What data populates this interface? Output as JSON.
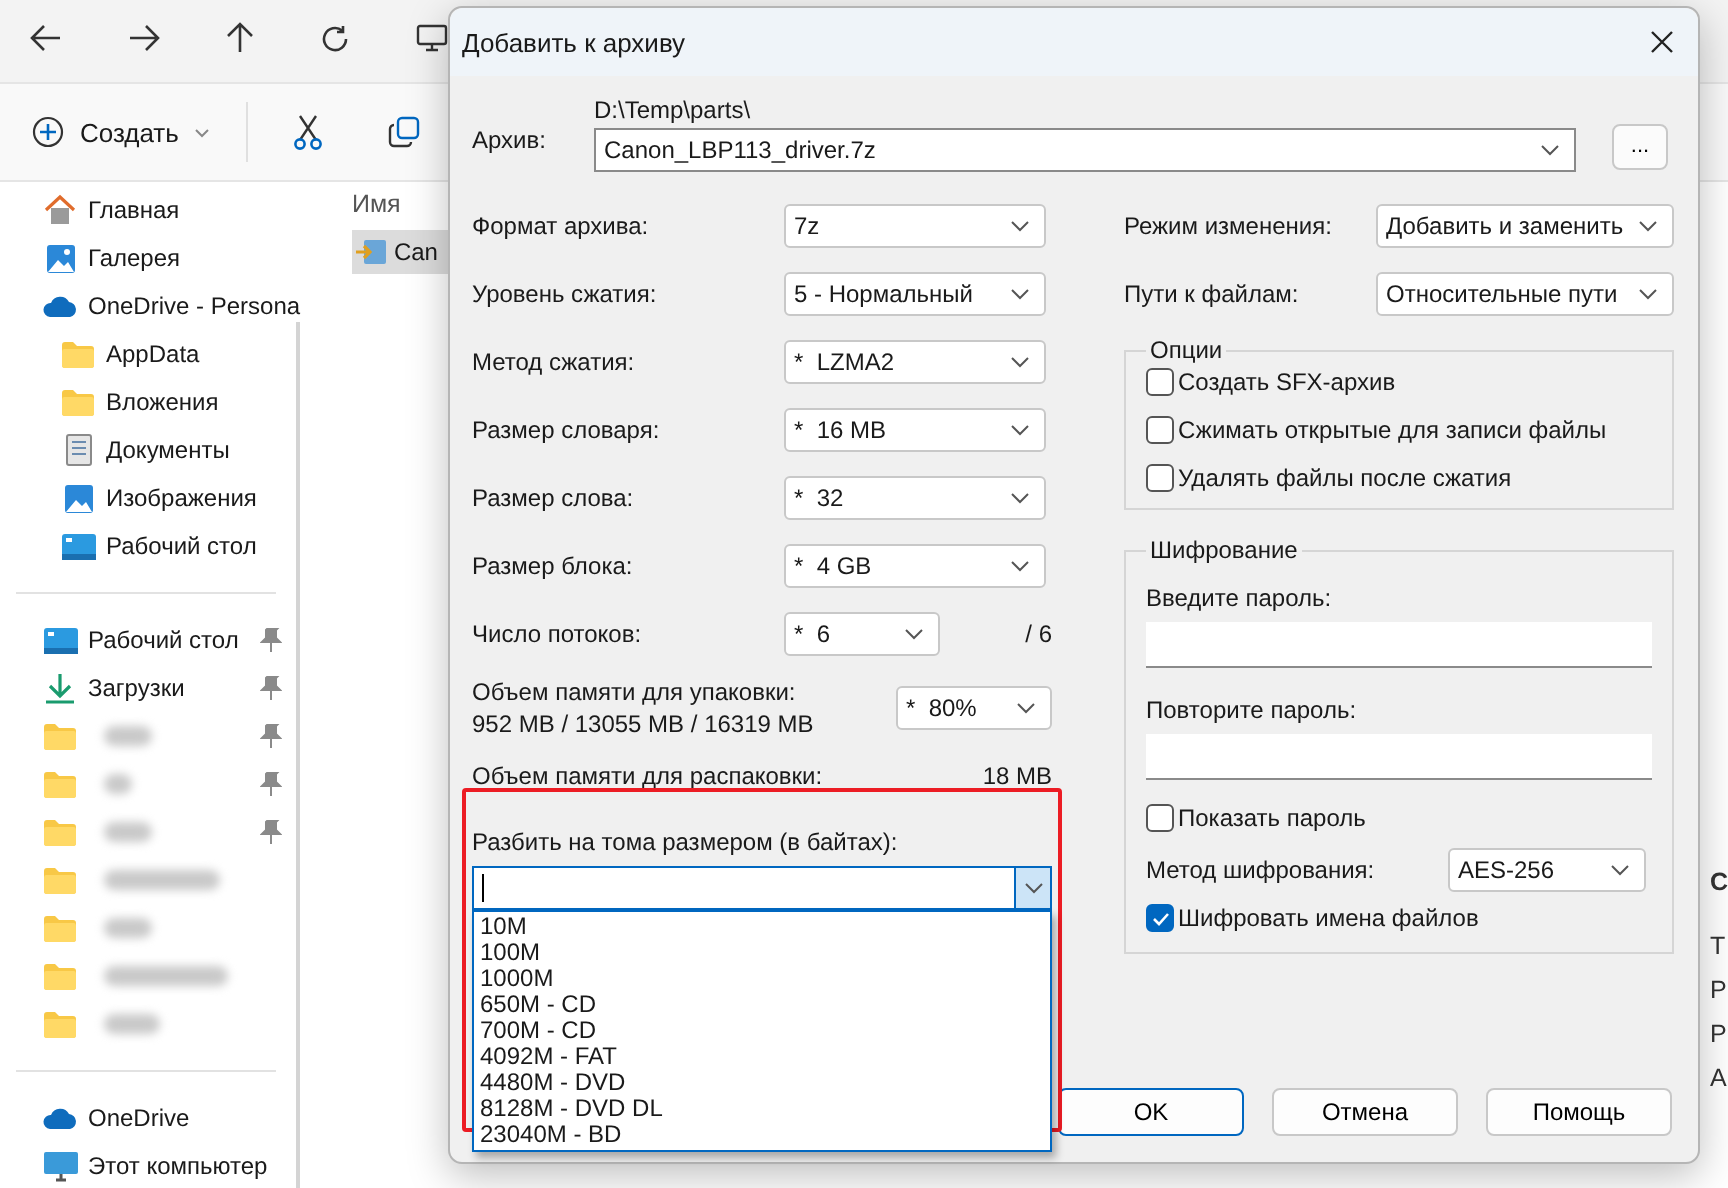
{
  "explorer": {
    "create_button": "Создать",
    "sidebar": {
      "groups": [
        {
          "items": [
            {
              "kind": "home",
              "label": "Главная"
            },
            {
              "kind": "gallery",
              "label": "Галерея"
            },
            {
              "kind": "cloud",
              "label": "OneDrive - Persona",
              "children": [
                {
                  "kind": "folder",
                  "label": "AppData"
                },
                {
                  "kind": "folder",
                  "label": "Вложения"
                },
                {
                  "kind": "docs",
                  "label": "Документы"
                },
                {
                  "kind": "pictures",
                  "label": "Изображения"
                },
                {
                  "kind": "desktop",
                  "label": "Рабочий стол"
                }
              ]
            }
          ]
        },
        {
          "items": [
            {
              "kind": "desktop",
              "label": "Рабочий стол",
              "pinned": true
            },
            {
              "kind": "download",
              "label": "Загрузки",
              "pinned": true
            },
            {
              "kind": "blurred-folder",
              "pinned": true
            },
            {
              "kind": "blurred-folder",
              "pinned": true
            },
            {
              "kind": "blurred-folder",
              "pinned": true
            },
            {
              "kind": "blurred-folder",
              "pinned": false
            },
            {
              "kind": "blurred-folder",
              "pinned": false
            },
            {
              "kind": "blurred-folder",
              "pinned": false
            },
            {
              "kind": "blurred-folder",
              "pinned": false
            }
          ]
        },
        {
          "items": [
            {
              "kind": "cloud",
              "label": "OneDrive"
            },
            {
              "kind": "pc",
              "label": "Этот компьютер"
            }
          ]
        }
      ]
    },
    "column_header": "Имя",
    "file_name": "Can",
    "details_letters": [
      "С",
      "Т",
      "Р",
      "Р",
      "А"
    ]
  },
  "dialog": {
    "title": "Добавить к архиву",
    "archive": {
      "label": "Архив:",
      "path": "D:\\Temp\\parts\\",
      "value": "Canon_LBP113_driver.7z",
      "browse_button": "..."
    },
    "left_fields": [
      {
        "label": "Формат архива:",
        "value": "7z"
      },
      {
        "label": "Уровень сжатия:",
        "value": "5 - Нормальный"
      },
      {
        "label": "Метод сжатия:",
        "value": "*  LZMA2"
      },
      {
        "label": "Размер словаря:",
        "value": "*  16 MB"
      },
      {
        "label": "Размер слова:",
        "value": "*  32"
      },
      {
        "label": "Размер блока:",
        "value": "*  4 GB"
      }
    ],
    "threads": {
      "label": "Число потоков:",
      "value": "*  6",
      "max": "/ 6"
    },
    "memory_pack": {
      "label": "Объем памяти для упаковки:",
      "detail": "952 MB / 13055 MB / 16319 MB",
      "value": "*  80%"
    },
    "memory_unpack": {
      "label": "Объем памяти для распаковки:",
      "value": "18 MB"
    },
    "split": {
      "label": "Разбить на тома размером (в байтах):",
      "options": [
        "10M",
        "100M",
        "1000M",
        "650M - CD",
        "700M - CD",
        "4092M - FAT",
        "4480M - DVD",
        "8128M - DVD DL",
        "23040M - BD"
      ]
    },
    "right_fields": [
      {
        "label": "Режим изменения:",
        "value": "Добавить и заменить"
      },
      {
        "label": "Пути к файлам:",
        "value": "Относительные пути"
      }
    ],
    "options": {
      "title": "Опции",
      "checkboxes": [
        {
          "label": "Создать SFX-архив",
          "checked": false
        },
        {
          "label": "Сжимать открытые для записи файлы",
          "checked": false
        },
        {
          "label": "Удалять файлы после сжатия",
          "checked": false
        }
      ]
    },
    "encryption": {
      "title": "Шифрование",
      "password_label": "Введите пароль:",
      "repeat_label": "Повторите пароль:",
      "show_password": {
        "label": "Показать пароль",
        "checked": false
      },
      "method": {
        "label": "Метод шифрования:",
        "value": "AES-256"
      },
      "encrypt_names": {
        "label": "Шифровать имена файлов",
        "checked": true
      }
    },
    "buttons": [
      "OK",
      "Отмена",
      "Помощь"
    ]
  }
}
